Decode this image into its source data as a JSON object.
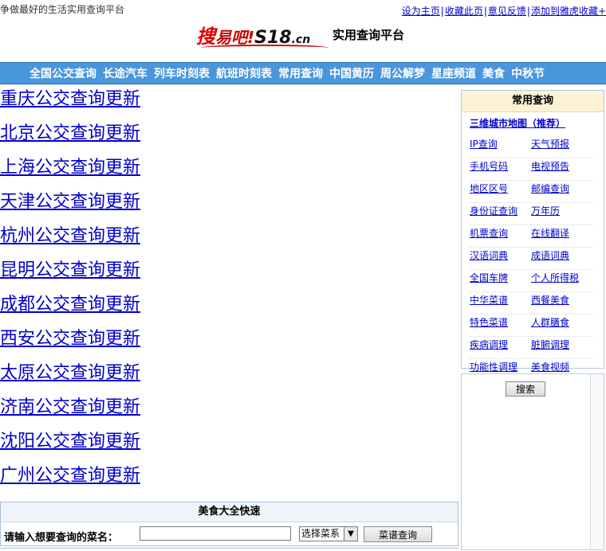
{
  "header": {
    "tagline": "争做最好的生活实用查询平台",
    "top_links": [
      "设为主页",
      "收藏此页",
      "意见反馈",
      "添加到雅虎收藏+"
    ],
    "logo": {
      "part1": "搜",
      "part2": "易吧!",
      "part3": "S18",
      "part4": ".cn"
    },
    "platform_label": "实用查询平台"
  },
  "nav": [
    "全国公交查询",
    "长途汽车",
    "列车时刻表",
    "航班时刻表",
    "常用查询",
    "中国黄历",
    "周公解梦",
    "星座频道",
    "美食",
    "中秋节"
  ],
  "bus_links": [
    "重庆公交查询更新",
    "北京公交查询更新",
    "上海公交查询更新",
    "天津公交查询更新",
    "杭州公交查询更新",
    "昆明公交查询更新",
    "成都公交查询更新",
    "西安公交查询更新",
    "太原公交查询更新",
    "济南公交查询更新",
    "沈阳公交查询更新",
    "广州公交查询更新"
  ],
  "common": {
    "title": "常用查询",
    "featured": "三维城市地图（推荐）",
    "tools": [
      "IP查询",
      "天气预报",
      "手机号码",
      "电视预告",
      "地区区号",
      "邮编查询",
      "身份证查询",
      "万年历",
      "机票查询",
      "在线翻译",
      "汉语词典",
      "成语词典",
      "全国车牌",
      "个人所得税",
      "中华菜谱",
      "西餐美食",
      "特色菜谱",
      "人群膳食",
      "疾病调理",
      "脏腑调理",
      "功能性调理",
      "美食视频"
    ]
  },
  "search": {
    "button": "搜索"
  },
  "food": {
    "title": "美食大全快速",
    "label": "请输入想要查询的菜名：",
    "input_value": "",
    "select_value": "选择菜系",
    "button": "菜谱查询"
  }
}
